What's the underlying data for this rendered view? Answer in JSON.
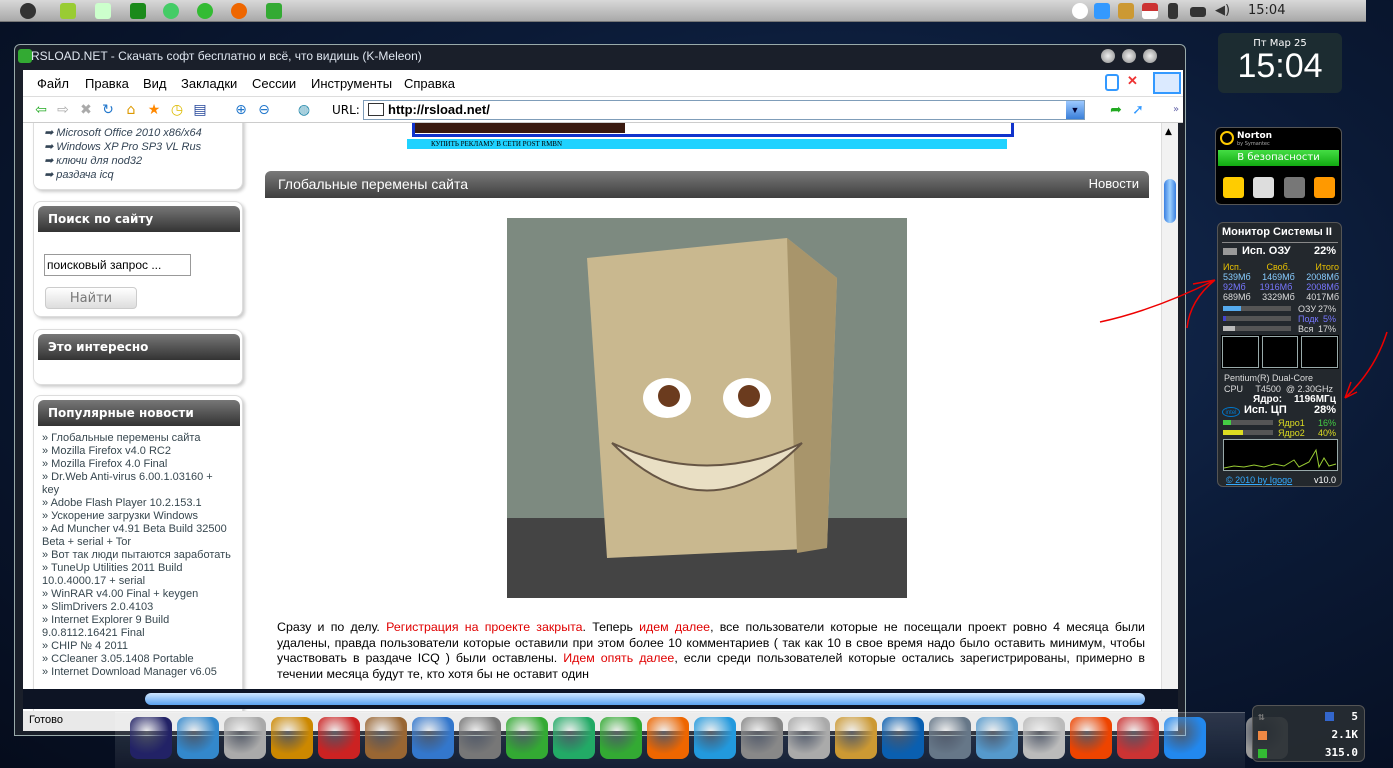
{
  "menubar": {
    "time": "15:04",
    "icons": [
      "apple-icon",
      "notepad-icon",
      "sticky-icon",
      "utorrent-icon",
      "network-icon",
      "icq-icon",
      "firefox-icon",
      "kmeleon-icon"
    ],
    "tray": [
      "cow-icon",
      "arrow-icon",
      "globe-shield-icon",
      "us-flag-icon",
      "battery-icon",
      "network-status-icon",
      "volume-icon"
    ]
  },
  "window": {
    "title": "RSLOAD.NET - Скачать софт бесплатно и всё, что видишь (K-Meleon)",
    "menu": [
      "Файл",
      "Правка",
      "Вид",
      "Закладки",
      "Сессии",
      "Инструменты",
      "Справка"
    ],
    "url_label": "URL:",
    "url": "http://rsload.net/",
    "status": "Готово"
  },
  "sidebar": {
    "links": [
      "Microsoft Office 2010 x86/x64",
      "Windows XP Pro SP3 VL Rus",
      "ключи для nod32",
      "раздача icq"
    ],
    "search": {
      "title": "Поиск по сайту",
      "placeholder": "поисковый запрос ...",
      "button": "Найти"
    },
    "interesting": {
      "title": "Это интересно"
    },
    "popular": {
      "title": "Популярные новости",
      "items": [
        "» Глобальные перемены сайта",
        "» Mozilla Firefox v4.0 RC2",
        "» Mozilla Firefox 4.0 Final",
        "» Dr.Web Anti-virus 6.00.1.03160 + key",
        "» Adobe Flash Player 10.2.153.1",
        "» Ускорение загрузки Windows",
        "» Ad Muncher v4.91 Beta Build 32500 Beta + serial + Tor",
        "» Вот так люди пытаются заработать",
        "» TuneUp Utilities 2011 Build 10.0.4000.17 + serial",
        "» WinRAR v4.00 Final + keygen",
        "» SlimDrivers 2.0.4103",
        "» Internet Explorer 9 Build 9.0.8112.16421 Final",
        "» CHIP № 4 2011",
        "» CCleaner 3.05.1408 Portable",
        "» Internet Download Manager v6.05"
      ]
    }
  },
  "main": {
    "ad_text": "КУПИТЬ РЕКЛАМУ В СЕТИ POST RMBN",
    "article_title": "Глобальные перемены сайта",
    "category": "Новости",
    "p": {
      "t1": "Сразу и по делу. ",
      "l1": "Регистрация на проекте закрыта",
      "t2": ". Теперь ",
      "l2": "идем далее",
      "t3": ", все пользователи которые не посещали проект ровно 4 месяца были удалены, правда пользователи которые оставили при этом более 10 комментариев ( так как 10 в свое время надо было оставить минимум, чтобы участвовать в раздаче ICQ ) были оставлены. ",
      "l3": "Идем опять далее",
      "t4": ", если среди пользователей которые остались зарегистрированы, примерно в течении месяца будут те, кто хотя бы не оставит один"
    }
  },
  "clock": {
    "date": "Пт Мар 25",
    "time": "15:04"
  },
  "norton": {
    "brand": "Norton",
    "sub": "by Symantec",
    "status": "В безопасности"
  },
  "monitor": {
    "title": "Монитор Системы II",
    "ram_label": "Исп. ОЗУ",
    "ram_pct": "22%",
    "cols": [
      "Исп.",
      "Своб.",
      "Итого"
    ],
    "rows": [
      [
        "539Мб",
        "1469Мб",
        "2008Мб"
      ],
      [
        "92Мб",
        "1916Мб",
        "2008Мб"
      ],
      [
        "689Мб",
        "3329Мб",
        "4017Мб"
      ]
    ],
    "bars": [
      {
        "label": "ОЗУ",
        "pct": "27%",
        "v": 27
      },
      {
        "label": "Подк",
        "pct": "5%",
        "v": 5
      },
      {
        "label": "Вся",
        "pct": "17%",
        "v": 17
      }
    ],
    "cpu1": "Pentium(R) Dual-Core",
    "cpu2": "CPU     T4500  @ 2.30GHz",
    "core_label": "Ядро:",
    "core_freq": "1196МГц",
    "cpu_label": "Исп. ЦП",
    "cpu_pct": "28%",
    "cores": [
      {
        "label": "Ядро1",
        "pct": "16%",
        "v": 16
      },
      {
        "label": "Ядро2",
        "pct": "40%",
        "v": 40
      }
    ],
    "footer": "© 2010 by Igogo",
    "version": "v10.0"
  },
  "net": {
    "v1": "5",
    "v2": "2.1K",
    "v3": "315.0"
  },
  "colors": {
    "link_red": "#e00000",
    "accent": "#3a7fe0"
  }
}
